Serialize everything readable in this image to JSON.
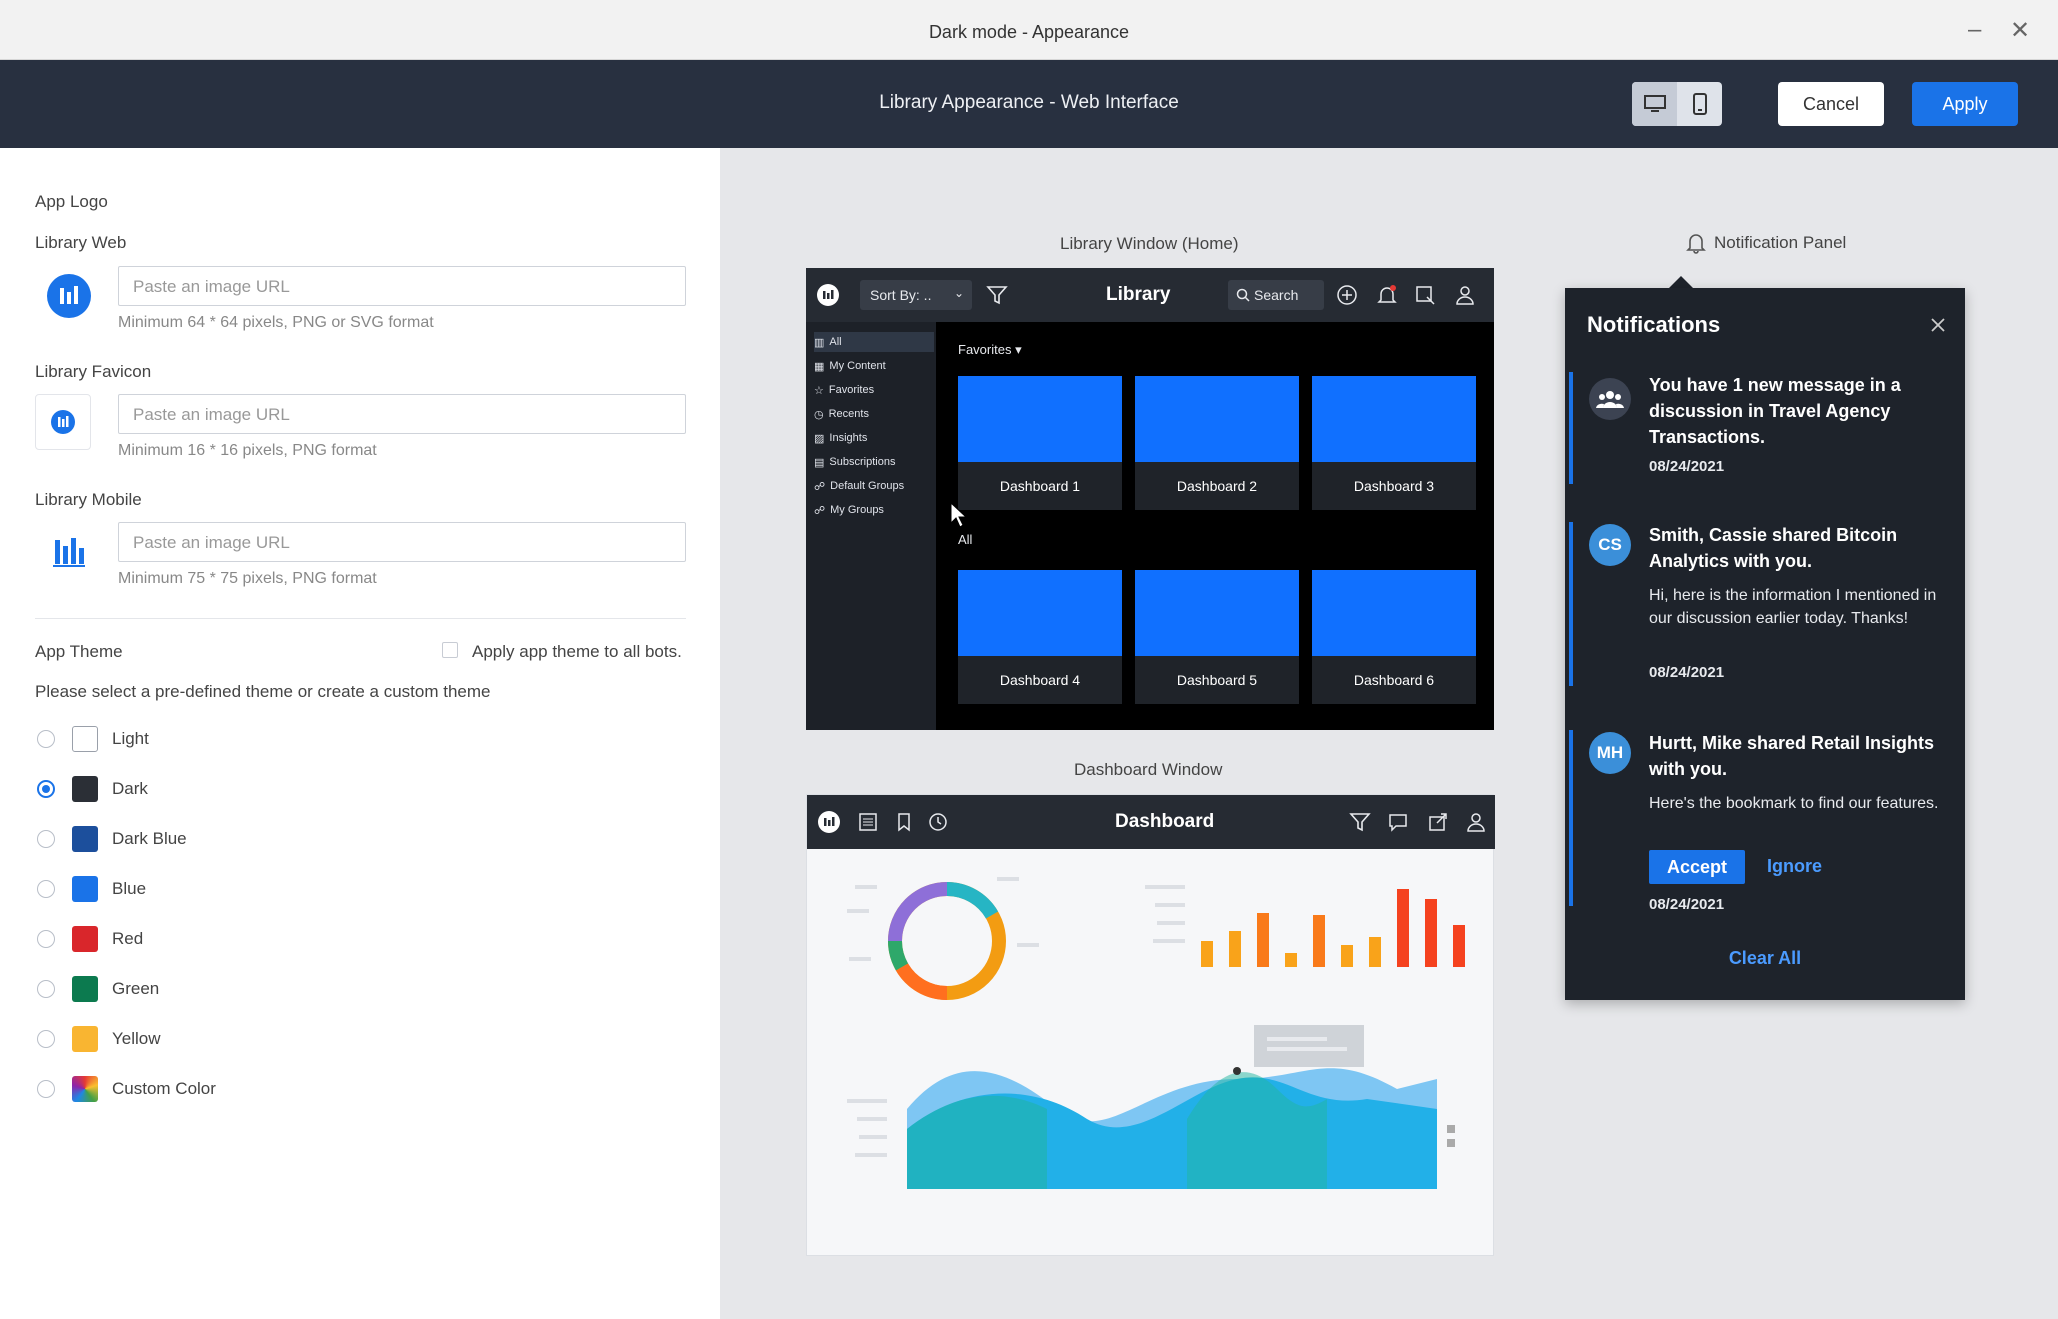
{
  "window": {
    "title": "Dark mode - Appearance",
    "minimize_label": "–",
    "close_label": "✕"
  },
  "header": {
    "title": "Library Appearance - Web Interface",
    "cancel_label": "Cancel",
    "apply_label": "Apply",
    "device_toggle": [
      "desktop-icon",
      "mobile-icon"
    ]
  },
  "logo_section": {
    "title": "App Logo",
    "fields": [
      {
        "label": "Library Web",
        "placeholder": "Paste an image URL",
        "hint": "Minimum 64 * 64 pixels, PNG or SVG format"
      },
      {
        "label": "Library Favicon",
        "placeholder": "Paste an image URL",
        "hint": "Minimum 16 * 16 pixels, PNG format"
      },
      {
        "label": "Library Mobile",
        "placeholder": "Paste an image URL",
        "hint": "Minimum 75 * 75 pixels, PNG format"
      }
    ]
  },
  "theme_section": {
    "title": "App Theme",
    "apply_all_label": "Apply app theme to all bots.",
    "apply_all_checked": false,
    "description": "Please select a pre-defined theme or create a custom theme",
    "selected": "Dark",
    "themes": [
      {
        "name": "Light",
        "color": "#ffffff"
      },
      {
        "name": "Dark",
        "color": "#2b2f36"
      },
      {
        "name": "Dark Blue",
        "color": "#1c4f9c"
      },
      {
        "name": "Blue",
        "color": "#1a73e8"
      },
      {
        "name": "Red",
        "color": "#d9262b"
      },
      {
        "name": "Green",
        "color": "#0c7a4f"
      },
      {
        "name": "Yellow",
        "color": "#f9b531"
      },
      {
        "name": "Custom Color",
        "color": "multicolor"
      }
    ]
  },
  "preview": {
    "library_caption": "Library Window (Home)",
    "dashboard_caption": "Dashboard Window",
    "notification_caption": "Notification Panel",
    "library": {
      "sort_label": "Sort By: ..",
      "title": "Library",
      "search_label": "Search",
      "sidebar": [
        "All",
        "My Content",
        "Favorites",
        "Recents",
        "Insights",
        "Subscriptions",
        "Default Groups",
        "My Groups"
      ],
      "favorites_label": "Favorites ▾",
      "all_label": "All",
      "dashboards": [
        "Dashboard 1",
        "Dashboard 2",
        "Dashboard 3",
        "Dashboard 4",
        "Dashboard 5",
        "Dashboard 6"
      ]
    },
    "dashboard": {
      "title": "Dashboard"
    }
  },
  "notifications": {
    "title": "Notifications",
    "clear_all_label": "Clear All",
    "items": [
      {
        "avatar": "group-icon",
        "title": "You have 1 new message in a discussion in Travel Agency Transactions.",
        "body": "",
        "date": "08/24/2021"
      },
      {
        "avatar": "CS",
        "title": "Smith, Cassie shared Bitcoin Analytics with you.",
        "body": "Hi, here is the information I mentioned in our discussion earlier today. Thanks!",
        "date": "08/24/2021"
      },
      {
        "avatar": "MH",
        "title": "Hurtt, Mike shared Retail Insights with you.",
        "body": "Here's the bookmark to find our features.",
        "date": "08/24/2021",
        "accept_label": "Accept",
        "ignore_label": "Ignore"
      }
    ]
  }
}
